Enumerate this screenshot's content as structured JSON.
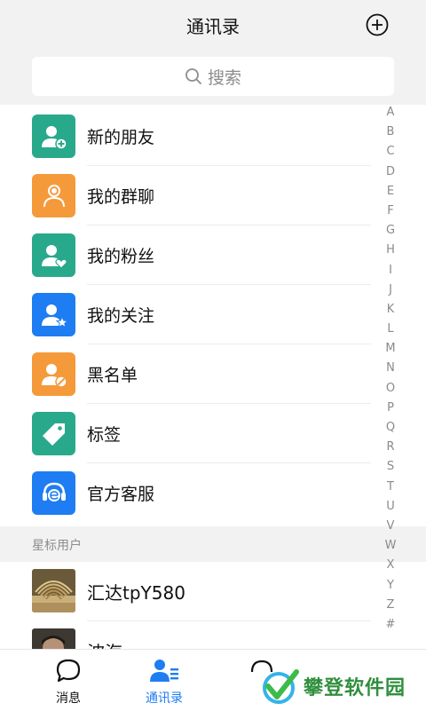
{
  "header": {
    "title": "通讯录",
    "add_icon": "plus-circle-icon"
  },
  "search": {
    "placeholder": "搜索",
    "icon": "search-icon"
  },
  "menu": [
    {
      "label": "新的朋友",
      "color": "#29a98b",
      "icon": "user-add-icon"
    },
    {
      "label": "我的群聊",
      "color": "#f59a3a",
      "icon": "group-icon"
    },
    {
      "label": "我的粉丝",
      "color": "#29a98b",
      "icon": "user-heart-icon"
    },
    {
      "label": "我的关注",
      "color": "#1e7df2",
      "icon": "user-star-icon"
    },
    {
      "label": "黑名单",
      "color": "#f59a3a",
      "icon": "user-block-icon"
    },
    {
      "label": "标签",
      "color": "#29a98b",
      "icon": "tag-icon"
    },
    {
      "label": "官方客服",
      "color": "#1e7df2",
      "icon": "headset-icon"
    }
  ],
  "section": {
    "starred_label": "星标用户"
  },
  "contacts": [
    {
      "name": "汇达tpY580"
    },
    {
      "name": "波海"
    }
  ],
  "index_letters": [
    "A",
    "B",
    "C",
    "D",
    "E",
    "F",
    "G",
    "H",
    "I",
    "J",
    "K",
    "L",
    "M",
    "N",
    "O",
    "P",
    "Q",
    "R",
    "S",
    "T",
    "U",
    "V",
    "W",
    "X",
    "Y",
    "Z",
    "#"
  ],
  "tabs": [
    {
      "label": "消息",
      "icon": "chat-bubble-icon",
      "active": false
    },
    {
      "label": "通讯录",
      "icon": "contacts-icon",
      "active": true
    }
  ],
  "colors": {
    "accent": "#1e7df2",
    "green": "#29a98b",
    "orange": "#f59a3a"
  },
  "watermark": {
    "text": "攀登软件园"
  }
}
